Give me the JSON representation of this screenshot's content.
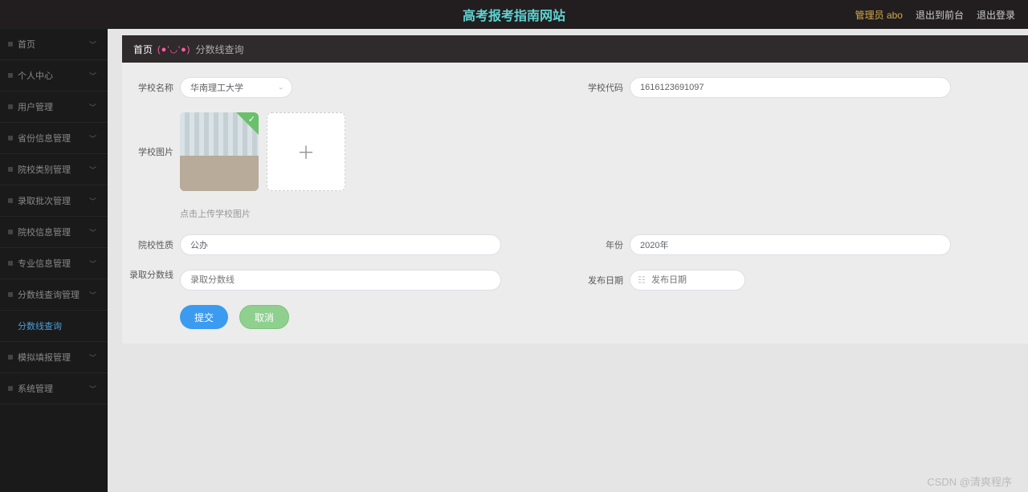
{
  "header": {
    "site_title": "高考报考指南网站",
    "admin_label": "管理员 abo",
    "logout_front": "退出到前台",
    "logout": "退出登录"
  },
  "sidebar": {
    "items": [
      {
        "label": "首页"
      },
      {
        "label": "个人中心"
      },
      {
        "label": "用户管理"
      },
      {
        "label": "省份信息管理"
      },
      {
        "label": "院校类别管理"
      },
      {
        "label": "录取批次管理"
      },
      {
        "label": "院校信息管理"
      },
      {
        "label": "专业信息管理"
      },
      {
        "label": "分数线查询管理"
      },
      {
        "label": "分数线查询",
        "sub": true,
        "active": true
      },
      {
        "label": "模拟填报管理"
      },
      {
        "label": "系统管理"
      }
    ]
  },
  "breadcrumb": {
    "home": "首页",
    "emoji": "(●'◡'●)",
    "current": "分数线查询"
  },
  "form": {
    "school_name_label": "学校名称",
    "school_name_value": "华南理工大学",
    "school_code_label": "学校代码",
    "school_code_value": "1616123691097",
    "school_img_label": "学校图片",
    "upload_hint": "点击上传学校图片",
    "school_type_label": "院校性质",
    "school_type_value": "公办",
    "year_label": "年份",
    "year_value": "2020年",
    "score_label": "录取分数线",
    "score_placeholder": "录取分数线",
    "pubdate_label": "发布日期",
    "pubdate_placeholder": "发布日期",
    "submit": "提交",
    "cancel": "取消"
  },
  "watermark": "CSDN @清爽程序"
}
